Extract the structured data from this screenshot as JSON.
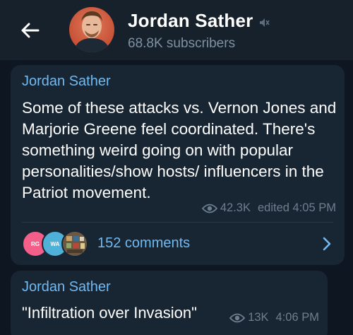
{
  "header": {
    "back_icon": "arrow-left-icon",
    "channel_name": "Jordan Sather",
    "muted_icon": "speaker-muted-icon",
    "subscribers": "68.8K subscribers"
  },
  "messages": [
    {
      "author": "Jordan Sather",
      "text": "Some of these attacks vs. Vernon Jones and Marjorie Greene feel coordinated. There's something weird going on with popular personalities/show hosts/ influencers in the Patriot movement.",
      "views": "42.3K",
      "time": "edited 4:05 PM",
      "comments": {
        "avatars": [
          "RG",
          "WA",
          ""
        ],
        "label": "152 comments"
      }
    },
    {
      "author": "Jordan Sather",
      "text": "\"Infiltration over Invasion\"",
      "views": "13K",
      "time": "4:06 PM"
    }
  ],
  "colors": {
    "background": "#0e1621",
    "header": "#17212b",
    "bubble": "#182533",
    "accent": "#71baf2",
    "muted": "#6d7f8f"
  }
}
